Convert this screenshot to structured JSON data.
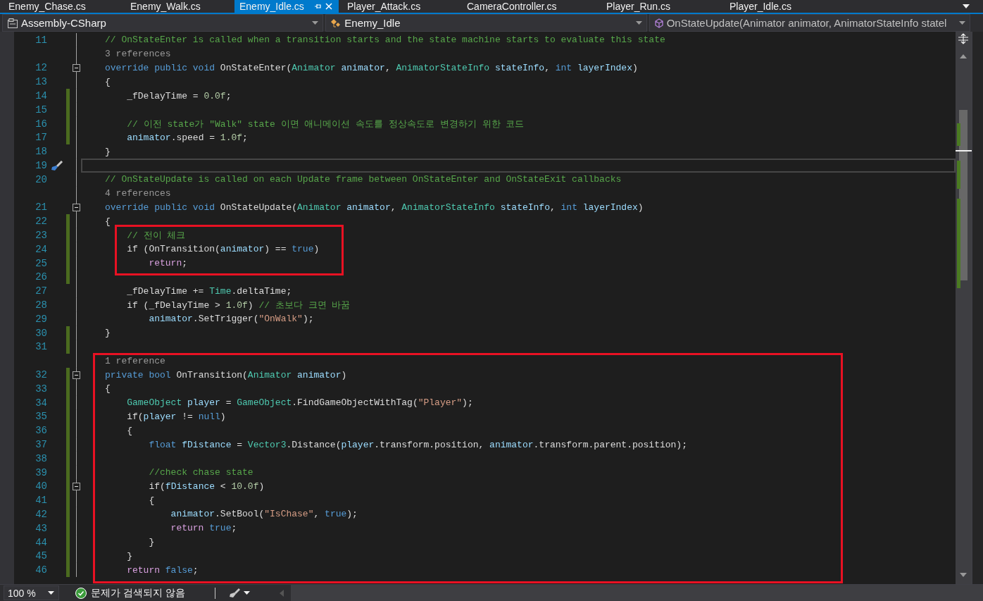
{
  "tabs": [
    {
      "label": "Enemy_Chase.cs",
      "selected": false
    },
    {
      "label": "Enemy_Walk.cs",
      "selected": false
    },
    {
      "label": "Enemy_Idle.cs",
      "selected": true
    },
    {
      "label": "Player_Attack.cs",
      "selected": false
    },
    {
      "label": "CameraController.cs",
      "selected": false
    },
    {
      "label": "Player_Run.cs",
      "selected": false
    },
    {
      "label": "Player_Idle.cs",
      "selected": false
    }
  ],
  "navigation": {
    "project": "Assembly-CSharp",
    "class": "Enemy_Idle",
    "member": "OnStateUpdate(Animator animator, AnimatorStateInfo statel"
  },
  "editor": {
    "blocks": [
      {
        "rows": [
          {
            "kind": "code",
            "n": "11",
            "changed": false,
            "fold": false,
            "code": [
              {
                "kind": "comment",
                "text": "// OnStateEnter is called when a transition starts and the state machine starts to evaluate this state"
              }
            ]
          },
          {
            "kind": "lens",
            "text": "3 references",
            "changed": false
          },
          {
            "kind": "code",
            "n": "12",
            "changed": false,
            "fold": true,
            "code": [
              {
                "kind": "keyword",
                "text": "override public void "
              },
              {
                "kind": "plain",
                "text": "OnStateEnter("
              },
              {
                "kind": "type",
                "text": "Animator"
              },
              {
                "kind": "var",
                "text": " animator"
              },
              {
                "kind": "plain",
                "text": ", "
              },
              {
                "kind": "type",
                "text": "AnimatorStateInfo"
              },
              {
                "kind": "var",
                "text": " stateInfo"
              },
              {
                "kind": "plain",
                "text": ", "
              },
              {
                "kind": "keyword",
                "text": "int"
              },
              {
                "kind": "var",
                "text": " layerIndex"
              },
              {
                "kind": "plain",
                "text": ")"
              }
            ]
          },
          {
            "kind": "code",
            "n": "13",
            "changed": false,
            "fold": false,
            "code": [
              {
                "kind": "plain",
                "text": "{"
              }
            ]
          },
          {
            "kind": "code",
            "n": "14",
            "changed": true,
            "fold": false,
            "code": [
              {
                "kind": "plain",
                "text": "    _fDelayTime = "
              },
              {
                "kind": "number",
                "text": "0.0f"
              },
              {
                "kind": "plain",
                "text": ";"
              }
            ]
          },
          {
            "kind": "code",
            "n": "15",
            "changed": true,
            "fold": false
          },
          {
            "kind": "code",
            "n": "16",
            "changed": true,
            "fold": false,
            "code": [
              {
                "kind": "comment",
                "text": "    // 이전 state가 \"Walk\" state 이면 애니메이션 속도를 정상속도로 변경하기 위한 코드"
              }
            ]
          },
          {
            "kind": "code",
            "n": "17",
            "changed": true,
            "fold": false,
            "code": [
              {
                "kind": "var",
                "text": "    animator"
              },
              {
                "kind": "plain",
                "text": ".speed = "
              },
              {
                "kind": "number",
                "text": "1.0f"
              },
              {
                "kind": "plain",
                "text": ";"
              }
            ]
          },
          {
            "kind": "code",
            "n": "18",
            "changed": false,
            "fold": false,
            "code": [
              {
                "kind": "plain",
                "text": "}"
              }
            ]
          },
          {
            "kind": "code",
            "n": "19",
            "changed": false,
            "fold": false,
            "current": true,
            "quick_action": true
          },
          {
            "kind": "code",
            "n": "20",
            "changed": false,
            "fold": false,
            "code": [
              {
                "kind": "comment",
                "text": "// OnStateUpdate is called on each Update frame between OnStateEnter and OnStateExit callbacks"
              }
            ]
          },
          {
            "kind": "lens",
            "text": "4 references",
            "changed": false
          },
          {
            "kind": "code",
            "n": "21",
            "changed": false,
            "fold": true,
            "code": [
              {
                "kind": "keyword",
                "text": "override public void "
              },
              {
                "kind": "plain",
                "text": "OnStateUpdate("
              },
              {
                "kind": "type",
                "text": "Animator"
              },
              {
                "kind": "var",
                "text": " animator"
              },
              {
                "kind": "plain",
                "text": ", "
              },
              {
                "kind": "type",
                "text": "AnimatorStateInfo"
              },
              {
                "kind": "var",
                "text": " stateInfo"
              },
              {
                "kind": "plain",
                "text": ", "
              },
              {
                "kind": "keyword",
                "text": "int"
              },
              {
                "kind": "var",
                "text": " layerIndex"
              },
              {
                "kind": "plain",
                "text": ")"
              }
            ]
          },
          {
            "kind": "code",
            "n": "22",
            "changed": true,
            "fold": false,
            "code": [
              {
                "kind": "plain",
                "text": "{"
              }
            ]
          }
        ]
      },
      {
        "kind": "tight",
        "rows": [
          {
            "kind": "code",
            "n": "23",
            "changed": true,
            "fold": false,
            "code": [
              {
                "kind": "comment",
                "text": "    // 전이 체크"
              }
            ]
          },
          {
            "kind": "code",
            "n": "24",
            "changed": true,
            "fold": false,
            "code": [
              {
                "kind": "plain",
                "text": "    if (OnTransition("
              },
              {
                "kind": "var",
                "text": "animator"
              },
              {
                "kind": "plain",
                "text": ") == "
              },
              {
                "kind": "keyword",
                "text": "true"
              },
              {
                "kind": "plain",
                "text": ")"
              }
            ]
          },
          {
            "kind": "code",
            "n": "25",
            "changed": true,
            "fold": false,
            "code": [
              {
                "kind": "control",
                "text": "        return"
              },
              {
                "kind": "plain",
                "text": ";"
              }
            ]
          }
        ]
      },
      {
        "rows": [
          {
            "kind": "code",
            "n": "26",
            "changed": true,
            "fold": false
          },
          {
            "kind": "code",
            "n": "27",
            "changed": false,
            "fold": false,
            "code": [
              {
                "kind": "plain",
                "text": "    _fDelayTime += "
              },
              {
                "kind": "type",
                "text": "Time"
              },
              {
                "kind": "plain",
                "text": ".deltaTime;"
              }
            ]
          },
          {
            "kind": "code",
            "n": "28",
            "changed": false,
            "fold": false,
            "code": [
              {
                "kind": "plain",
                "text": "    if (_fDelayTime > "
              },
              {
                "kind": "number",
                "text": "1.0f"
              },
              {
                "kind": "plain",
                "text": ") "
              },
              {
                "kind": "comment",
                "text": "// 초보다 크면 바꿈"
              }
            ]
          },
          {
            "kind": "code",
            "n": "29",
            "changed": false,
            "fold": false,
            "code": [
              {
                "kind": "var",
                "text": "        animator"
              },
              {
                "kind": "plain",
                "text": ".SetTrigger("
              },
              {
                "kind": "string",
                "text": "\"OnWalk\""
              },
              {
                "kind": "plain",
                "text": ");"
              }
            ]
          },
          {
            "kind": "code",
            "n": "30",
            "changed": true,
            "fold": false,
            "code": [
              {
                "kind": "plain",
                "text": "}"
              }
            ]
          },
          {
            "kind": "code",
            "n": "31",
            "changed": true,
            "fold": false
          }
        ]
      },
      {
        "kind": "wide",
        "rows": [
          {
            "kind": "lens",
            "text": "1 reference",
            "changed": false
          },
          {
            "kind": "code",
            "n": "32",
            "changed": true,
            "fold": true,
            "code": [
              {
                "kind": "keyword",
                "text": "private bool "
              },
              {
                "kind": "plain",
                "text": "OnTransition("
              },
              {
                "kind": "type",
                "text": "Animator"
              },
              {
                "kind": "var",
                "text": " animator"
              },
              {
                "kind": "plain",
                "text": ")"
              }
            ]
          },
          {
            "kind": "code",
            "n": "33",
            "changed": true,
            "fold": false,
            "code": [
              {
                "kind": "plain",
                "text": "{"
              }
            ]
          },
          {
            "kind": "code",
            "n": "34",
            "changed": true,
            "fold": false,
            "code": [
              {
                "kind": "type",
                "text": "    GameObject"
              },
              {
                "kind": "var",
                "text": " player"
              },
              {
                "kind": "plain",
                "text": " = "
              },
              {
                "kind": "type",
                "text": "GameObject"
              },
              {
                "kind": "plain",
                "text": ".FindGameObjectWithTag("
              },
              {
                "kind": "string",
                "text": "\"Player\""
              },
              {
                "kind": "plain",
                "text": ");"
              }
            ]
          },
          {
            "kind": "code",
            "n": "35",
            "changed": true,
            "fold": false,
            "code": [
              {
                "kind": "plain",
                "text": "    if("
              },
              {
                "kind": "var",
                "text": "player"
              },
              {
                "kind": "plain",
                "text": " != "
              },
              {
                "kind": "keyword",
                "text": "null"
              },
              {
                "kind": "plain",
                "text": ")"
              }
            ]
          },
          {
            "kind": "code",
            "n": "36",
            "changed": true,
            "fold": false,
            "code": [
              {
                "kind": "plain",
                "text": "    {"
              }
            ]
          },
          {
            "kind": "code",
            "n": "37",
            "changed": true,
            "fold": false,
            "code": [
              {
                "kind": "keyword",
                "text": "        float"
              },
              {
                "kind": "var",
                "text": " fDistance"
              },
              {
                "kind": "plain",
                "text": " = "
              },
              {
                "kind": "type",
                "text": "Vector3"
              },
              {
                "kind": "plain",
                "text": ".Distance("
              },
              {
                "kind": "var",
                "text": "player"
              },
              {
                "kind": "plain",
                "text": ".transform.position, "
              },
              {
                "kind": "var",
                "text": "animator"
              },
              {
                "kind": "plain",
                "text": ".transform.parent.position);"
              }
            ]
          },
          {
            "kind": "code",
            "n": "38",
            "changed": true,
            "fold": false
          },
          {
            "kind": "code",
            "n": "39",
            "changed": true,
            "fold": false,
            "code": [
              {
                "kind": "comment",
                "text": "        //check chase state"
              }
            ]
          },
          {
            "kind": "code",
            "n": "40",
            "changed": true,
            "fold": true,
            "code": [
              {
                "kind": "plain",
                "text": "        if("
              },
              {
                "kind": "var",
                "text": "fDistance"
              },
              {
                "kind": "plain",
                "text": " < "
              },
              {
                "kind": "number",
                "text": "10.0f"
              },
              {
                "kind": "plain",
                "text": ")"
              }
            ]
          },
          {
            "kind": "code",
            "n": "41",
            "changed": true,
            "fold": false,
            "code": [
              {
                "kind": "plain",
                "text": "        {"
              }
            ]
          },
          {
            "kind": "code",
            "n": "42",
            "changed": true,
            "fold": false,
            "code": [
              {
                "kind": "var",
                "text": "            animator"
              },
              {
                "kind": "plain",
                "text": ".SetBool("
              },
              {
                "kind": "string",
                "text": "\"IsChase\""
              },
              {
                "kind": "plain",
                "text": ", "
              },
              {
                "kind": "keyword",
                "text": "true"
              },
              {
                "kind": "plain",
                "text": ");"
              }
            ]
          },
          {
            "kind": "code",
            "n": "43",
            "changed": true,
            "fold": false,
            "code": [
              {
                "kind": "control",
                "text": "            return"
              },
              {
                "kind": "keyword",
                "text": " true"
              },
              {
                "kind": "plain",
                "text": ";"
              }
            ]
          },
          {
            "kind": "code",
            "n": "44",
            "changed": true,
            "fold": false,
            "code": [
              {
                "kind": "plain",
                "text": "        }"
              }
            ]
          },
          {
            "kind": "code",
            "n": "45",
            "changed": true,
            "fold": false,
            "code": [
              {
                "kind": "plain",
                "text": "    }"
              }
            ]
          },
          {
            "kind": "code",
            "n": "46",
            "changed": true,
            "fold": false,
            "code": [
              {
                "kind": "control",
                "text": "    return"
              },
              {
                "kind": "keyword",
                "text": " false"
              },
              {
                "kind": "plain",
                "text": ";"
              }
            ]
          }
        ]
      }
    ]
  },
  "status_bar": {
    "zoom": "100 %",
    "issues": "문제가 검색되지 않음"
  }
}
